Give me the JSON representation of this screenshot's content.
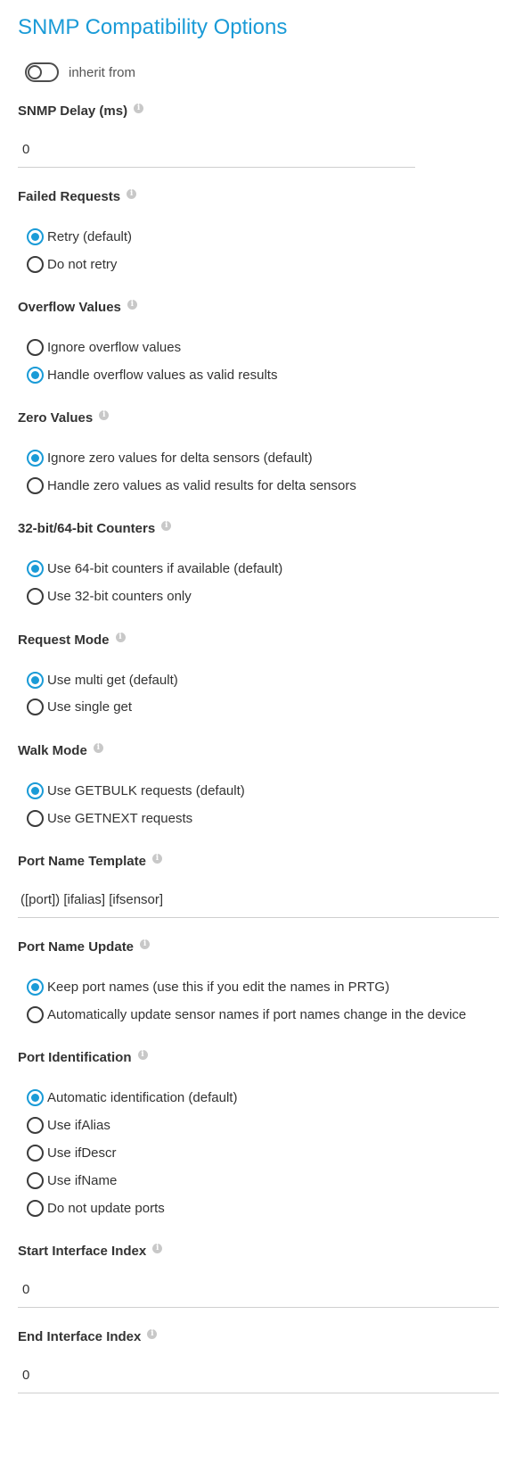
{
  "page_title": "SNMP Compatibility Options",
  "inherit": {
    "label": "inherit from",
    "enabled": false
  },
  "snmp_delay": {
    "label": "SNMP Delay (ms)",
    "value": "0"
  },
  "failed_requests": {
    "label": "Failed Requests",
    "options": [
      {
        "label": "Retry (default)",
        "checked": true
      },
      {
        "label": "Do not retry",
        "checked": false
      }
    ]
  },
  "overflow_values": {
    "label": "Overflow Values",
    "options": [
      {
        "label": "Ignore overflow values",
        "checked": false
      },
      {
        "label": "Handle overflow values as valid results",
        "checked": true
      }
    ]
  },
  "zero_values": {
    "label": "Zero Values",
    "options": [
      {
        "label": "Ignore zero values for delta sensors (default)",
        "checked": true
      },
      {
        "label": "Handle zero values as valid results for delta sensors",
        "checked": false
      }
    ]
  },
  "counters": {
    "label": "32-bit/64-bit Counters",
    "options": [
      {
        "label": "Use 64-bit counters if available (default)",
        "checked": true
      },
      {
        "label": "Use 32-bit counters only",
        "checked": false
      }
    ]
  },
  "request_mode": {
    "label": "Request Mode",
    "options": [
      {
        "label": "Use multi get (default)",
        "checked": true
      },
      {
        "label": "Use single get",
        "checked": false
      }
    ]
  },
  "walk_mode": {
    "label": "Walk Mode",
    "options": [
      {
        "label": "Use GETBULK requests (default)",
        "checked": true
      },
      {
        "label": "Use GETNEXT requests",
        "checked": false
      }
    ]
  },
  "port_name_template": {
    "label": "Port Name Template",
    "value": "([port]) [ifalias] [ifsensor]"
  },
  "port_name_update": {
    "label": "Port Name Update",
    "options": [
      {
        "label": "Keep port names (use this if you edit the names in PRTG)",
        "checked": true
      },
      {
        "label": "Automatically update sensor names if port names change in the device",
        "checked": false
      }
    ]
  },
  "port_identification": {
    "label": "Port Identification",
    "options": [
      {
        "label": "Automatic identification (default)",
        "checked": true
      },
      {
        "label": "Use ifAlias",
        "checked": false
      },
      {
        "label": "Use ifDescr",
        "checked": false
      },
      {
        "label": "Use ifName",
        "checked": false
      },
      {
        "label": "Do not update ports",
        "checked": false
      }
    ]
  },
  "start_interface_index": {
    "label": "Start Interface Index",
    "value": "0"
  },
  "end_interface_index": {
    "label": "End Interface Index",
    "value": "0"
  },
  "info_icon_glyph": "i",
  "colors": {
    "accent": "#1a9bd7",
    "text": "#333333",
    "info_icon": "#c8c8c8",
    "underline": "#cfcfcf"
  }
}
